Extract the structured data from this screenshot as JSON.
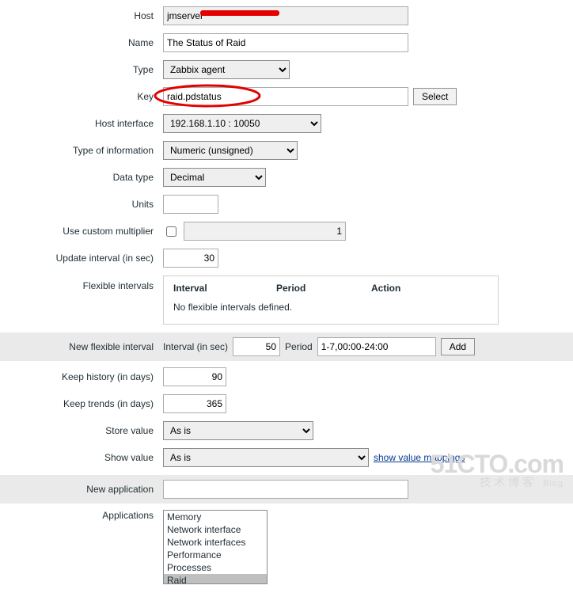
{
  "host": {
    "label": "Host",
    "value": "jmserver"
  },
  "name": {
    "label": "Name",
    "value": "The Status of Raid"
  },
  "type": {
    "label": "Type",
    "value": "Zabbix agent"
  },
  "key": {
    "label": "Key",
    "value": "raid.pdstatus",
    "select_btn": "Select"
  },
  "host_interface": {
    "label": "Host interface",
    "value": "192.168.1.10 : 10050"
  },
  "info_type": {
    "label": "Type of information",
    "value": "Numeric (unsigned)"
  },
  "data_type": {
    "label": "Data type",
    "value": "Decimal"
  },
  "units": {
    "label": "Units",
    "value": ""
  },
  "custom_mult": {
    "label": "Use custom multiplier",
    "checked": false,
    "value": "1"
  },
  "update_interval": {
    "label": "Update interval (in sec)",
    "value": "30"
  },
  "flex_intervals": {
    "label": "Flexible intervals",
    "col_interval": "Interval",
    "col_period": "Period",
    "col_action": "Action",
    "empty_text": "No flexible intervals defined."
  },
  "new_flex": {
    "label": "New flexible interval",
    "interval_label": "Interval (in sec)",
    "interval_value": "50",
    "period_label": "Period",
    "period_value": "1-7,00:00-24:00",
    "add_btn": "Add"
  },
  "history": {
    "label": "Keep history (in days)",
    "value": "90"
  },
  "trends": {
    "label": "Keep trends (in days)",
    "value": "365"
  },
  "store_value": {
    "label": "Store value",
    "value": "As is"
  },
  "show_value": {
    "label": "Show value",
    "value": "As is",
    "link": "show value mappings"
  },
  "new_app": {
    "label": "New application",
    "value": ""
  },
  "applications": {
    "label": "Applications",
    "options": [
      "Memory",
      "Network interface",
      "Network interfaces",
      "Performance",
      "Processes",
      "Raid"
    ],
    "selected": "Raid"
  },
  "watermark": {
    "big": "51CTO.com",
    "sub": "技术博客",
    "blog": "Blog"
  }
}
